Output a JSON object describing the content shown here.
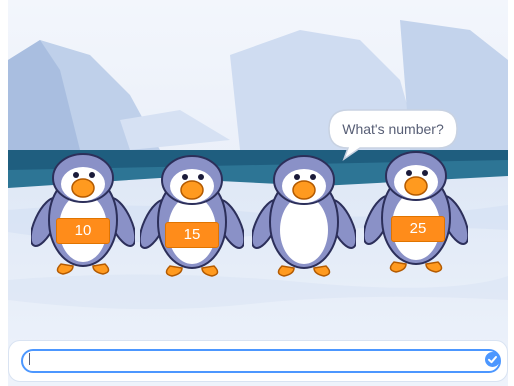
{
  "scene": {
    "description_colors": {
      "sky": "#e9eef8",
      "ice": "#c6d6ee",
      "water": "#1f5e7f",
      "snow": "#e8f0fb"
    }
  },
  "penguins": [
    {
      "badge": "10"
    },
    {
      "badge": "15"
    },
    {
      "badge": ""
    },
    {
      "badge": "25"
    }
  ],
  "speech_bubble": {
    "text": "What's number?"
  },
  "ask_box": {
    "value": "",
    "submit_icon": "check-icon"
  },
  "colors": {
    "badge": "#ff8c1a",
    "accent": "#4c97ff",
    "text": "#575e75"
  }
}
